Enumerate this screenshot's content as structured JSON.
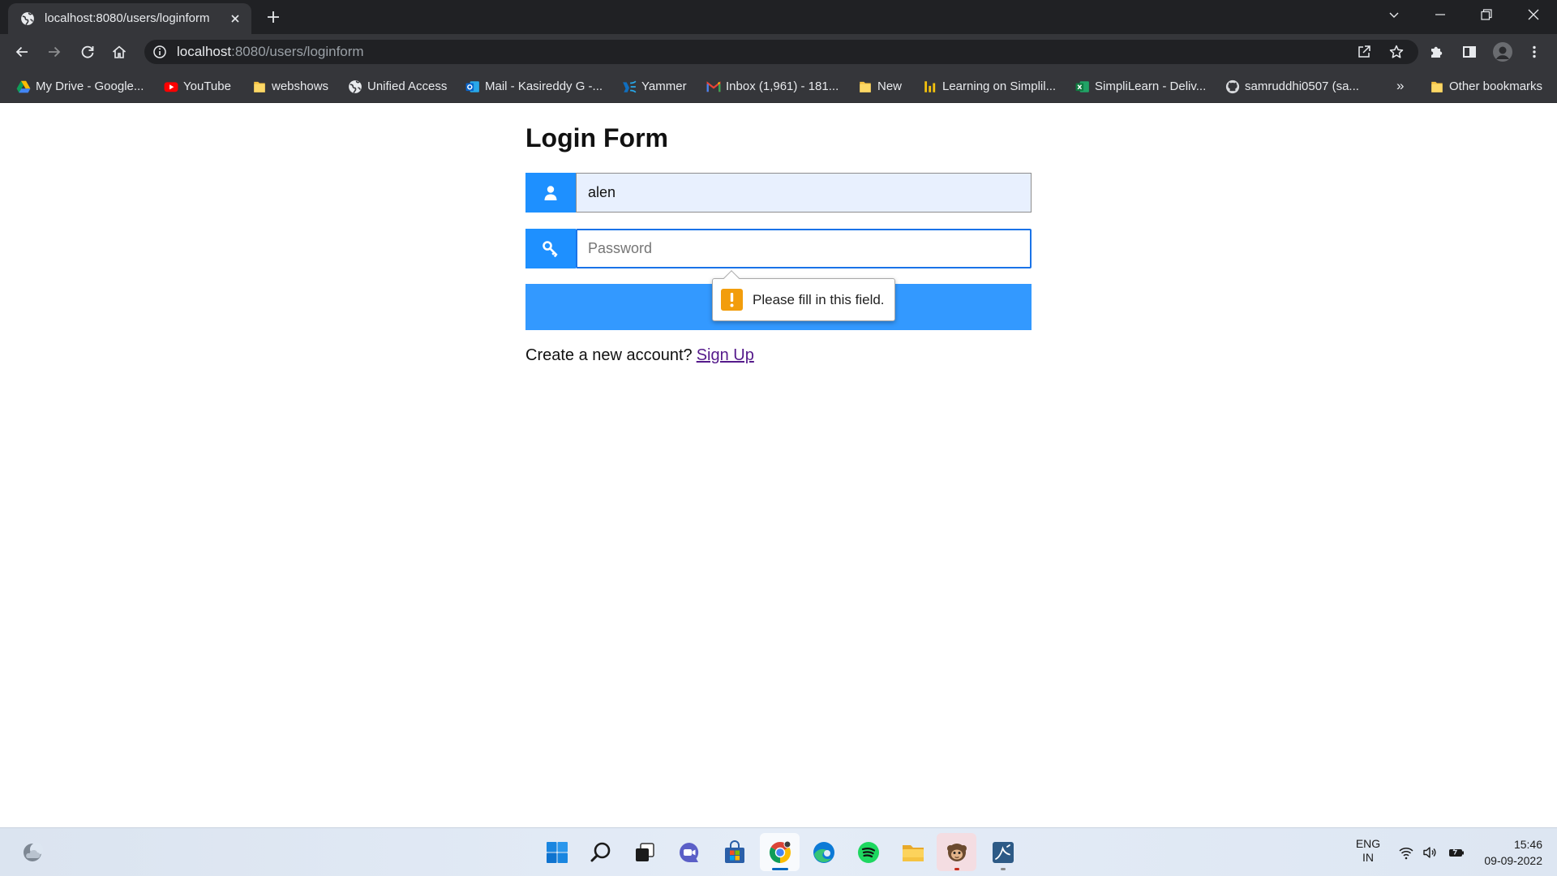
{
  "browser": {
    "active_tab": {
      "title": "localhost:8080/users/loginform",
      "favicon": "globe-icon"
    },
    "url": {
      "host": "localhost",
      "path": ":8080/users/loginform"
    },
    "bookmarks": [
      {
        "label": "My Drive - Google...",
        "icon": "google-drive-icon"
      },
      {
        "label": "YouTube",
        "icon": "youtube-icon"
      },
      {
        "label": "webshows",
        "icon": "folder-icon"
      },
      {
        "label": "Unified Access",
        "icon": "globe-icon"
      },
      {
        "label": "Mail - Kasireddy G -...",
        "icon": "outlook-icon"
      },
      {
        "label": "Yammer",
        "icon": "yammer-icon"
      },
      {
        "label": "Inbox (1,961) - 181...",
        "icon": "gmail-icon"
      },
      {
        "label": "New",
        "icon": "folder-icon"
      },
      {
        "label": "Learning on Simplil...",
        "icon": "simplilearn-icon"
      },
      {
        "label": "SimpliLearn - Deliv...",
        "icon": "excel-icon"
      },
      {
        "label": "samruddhi0507 (sa...",
        "icon": "github-icon"
      }
    ],
    "bookmarks_overflow": "»",
    "other_bookmarks": {
      "label": "Other bookmarks",
      "icon": "folder-icon"
    }
  },
  "login_form": {
    "title": "Login Form",
    "username": {
      "value": "alen",
      "icon": "user-icon"
    },
    "password": {
      "placeholder": "Password",
      "icon": "key-icon"
    },
    "validation_tooltip": {
      "message": "Please fill in this field.",
      "icon": "warning-icon"
    },
    "signup": {
      "prompt": "Create a new account?",
      "link": "Sign Up"
    }
  },
  "taskbar": {
    "widgets_icon": "weather-icon",
    "pinned_apps": [
      "windows-start-icon",
      "search-icon",
      "task-view-icon",
      "teams-chat-icon",
      "microsoft-store-icon",
      "chrome-icon",
      "edge-icon",
      "spotify-icon",
      "file-explorer-icon",
      "avatar-app-icon",
      "mysql-workbench-icon"
    ],
    "active_app": "chrome-icon",
    "tray_icons": [
      "wifi-icon",
      "volume-icon",
      "battery-charging-icon"
    ],
    "language": "ENG",
    "region": "IN",
    "time": "15:46",
    "date": "09-09-2022"
  },
  "colors": {
    "browser_frame": "#202124",
    "browser_toolbar": "#35363a",
    "field_icon_bg": "#1e90ff",
    "login_button_bg": "#3399ff",
    "focus_border": "#1a73e8",
    "autofill_bg": "#e8f0fe",
    "visited_link": "#551a8b",
    "warning": "#f29d0c"
  }
}
